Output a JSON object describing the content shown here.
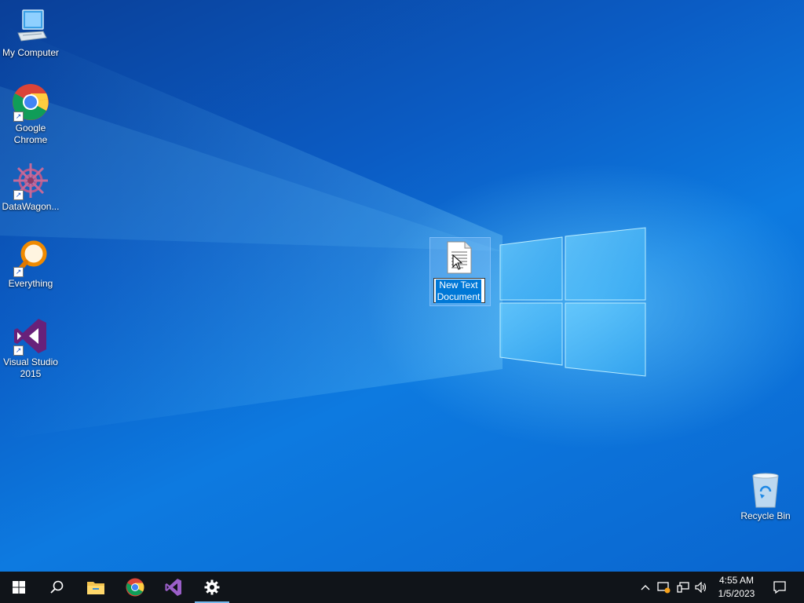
{
  "desktop": {
    "icons": [
      {
        "label": "My Computer"
      },
      {
        "label": "Google Chrome"
      },
      {
        "label": "DataWagon..."
      },
      {
        "label": "Everything"
      },
      {
        "label": "Visual Studio 2015"
      },
      {
        "label": "Recycle Bin"
      }
    ],
    "selected_file": {
      "label": "New Text Document"
    }
  },
  "taskbar": {
    "buttons": [
      {
        "name": "start-icon"
      },
      {
        "name": "search-icon"
      },
      {
        "name": "file-explorer-icon"
      },
      {
        "name": "chrome-icon"
      },
      {
        "name": "visual-studio-icon"
      },
      {
        "name": "settings-icon",
        "active": true
      }
    ],
    "tray": {
      "icons": [
        "chevron-up-icon",
        "security-alert-icon",
        "network-icon",
        "volume-icon"
      ],
      "time": "4:55 AM",
      "date": "1/5/2023"
    }
  },
  "colors": {
    "accent": "#0078d7",
    "taskbar": "#101419",
    "desktop": "#0b6fd6"
  }
}
